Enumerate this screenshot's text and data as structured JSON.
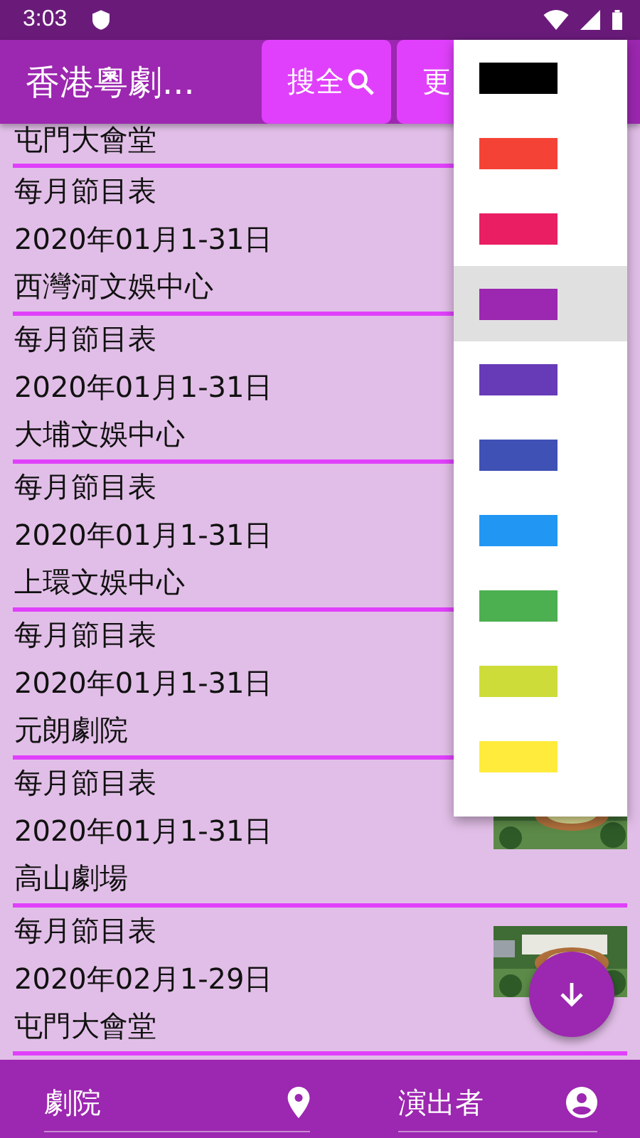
{
  "status_bar": {
    "time": "3:03"
  },
  "app_bar": {
    "title": "香港粵劇...",
    "buttons": [
      {
        "label": "搜全"
      },
      {
        "label": "更"
      }
    ]
  },
  "list": [
    {
      "venue": "屯門大會堂"
    },
    {
      "title": "每月節目表",
      "date": "2020年01月1-31日",
      "venue": "西灣河文娛中心"
    },
    {
      "title": "每月節目表",
      "date": "2020年01月1-31日",
      "venue": "大埔文娛中心"
    },
    {
      "title": "每月節目表",
      "date": "2020年01月1-31日",
      "venue": "上環文娛中心"
    },
    {
      "title": "每月節目表",
      "date": "2020年01月1-31日",
      "venue": "元朗劇院"
    },
    {
      "title": "每月節目表",
      "date": "2020年01月1-31日",
      "venue": "高山劇場"
    },
    {
      "title": "每月節目表",
      "date": "2020年02月1-29日",
      "venue": "屯門大會堂"
    }
  ],
  "color_menu": [
    {
      "color": "#000000",
      "selected": false
    },
    {
      "color": "#f44336",
      "selected": false
    },
    {
      "color": "#e91e63",
      "selected": false
    },
    {
      "color": "#9c27b0",
      "selected": true
    },
    {
      "color": "#673ab7",
      "selected": false
    },
    {
      "color": "#3f51b5",
      "selected": false
    },
    {
      "color": "#2196f3",
      "selected": false
    },
    {
      "color": "#4caf50",
      "selected": false
    },
    {
      "color": "#cddc39",
      "selected": false
    },
    {
      "color": "#ffeb3b",
      "selected": false
    }
  ],
  "bottom_bar": [
    {
      "label": "劇院"
    },
    {
      "label": "演出者"
    }
  ]
}
